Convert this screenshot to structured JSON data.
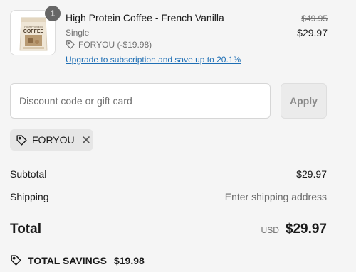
{
  "line_item": {
    "quantity": "1",
    "title": "High Protein Coffee - French Vanilla",
    "variant": "Single",
    "discount": "FORYOU (-$19.98)",
    "upgrade_link": "Upgrade to subscription and save up to 20.1%",
    "compare_at_price": "$49.95",
    "price": "$29.97",
    "thumbnail_label": "COFFEE"
  },
  "discount_form": {
    "placeholder": "Discount code or gift card",
    "apply_label": "Apply"
  },
  "applied_code": {
    "code": "FORYOU"
  },
  "summary": {
    "subtotal_label": "Subtotal",
    "subtotal_value": "$29.97",
    "shipping_label": "Shipping",
    "shipping_value": "Enter shipping address",
    "total_label": "Total",
    "currency": "USD",
    "total_value": "$29.97",
    "savings_label": "TOTAL SAVINGS",
    "savings_value": "$19.98"
  },
  "icons": {
    "discount_tag": "tag-icon",
    "remove": "close-icon"
  },
  "colors": {
    "link": "#1f6fb5",
    "background": "#f5f5f5",
    "badge": "#666666"
  }
}
